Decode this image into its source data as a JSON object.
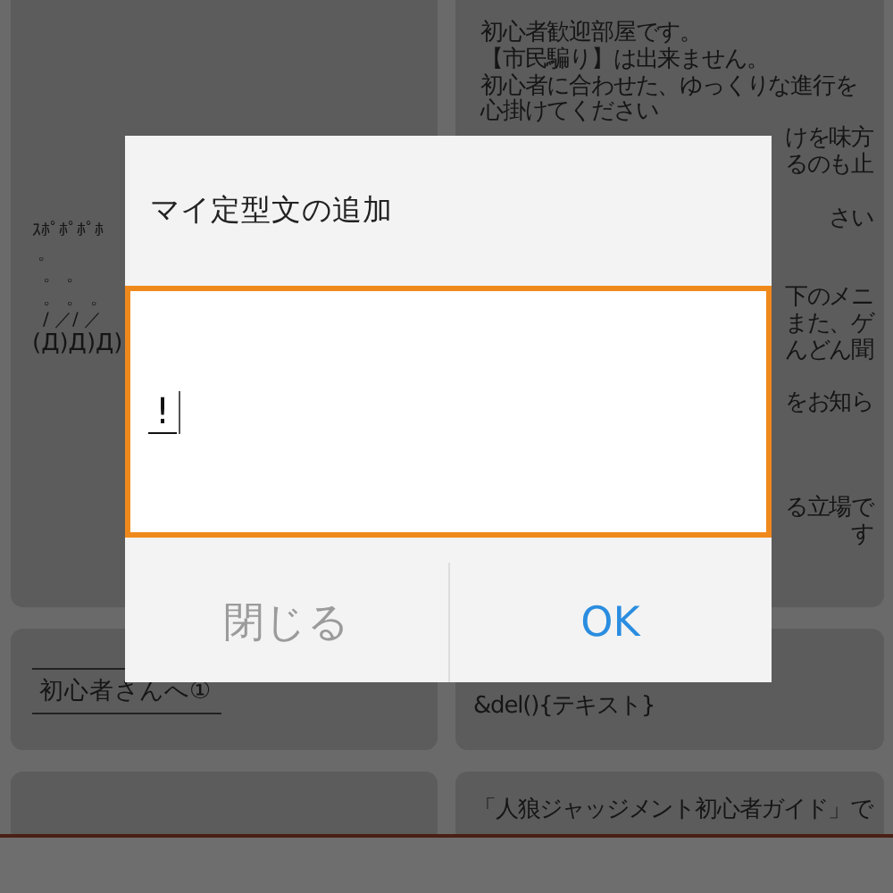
{
  "background": {
    "art": [
      "ｽﾎﾟﾎﾟﾎﾟﾎ",
      "。",
      "。 。",
      "。 。 。",
      "/ ／/ ／",
      "(Д)Д)Д)"
    ],
    "rules": [
      "初心者歓迎部屋です。",
      "【市民騙り】は出来ません。",
      "初心者に合わせた、ゆっくりな進行を",
      "心掛けてください",
      "けを味方",
      "るのも止",
      "さい",
      "下のメニ",
      "また、ゲ",
      "んどん聞",
      "をお知ら",
      "る立場で",
      "す"
    ],
    "link_label": "初心者さんへ①",
    "del_text": "&del(){テキスト}",
    "guide_text": "「人狼ジャッジメント初心者ガイド」で"
  },
  "dialog": {
    "title": "マイ定型文の追加",
    "input": {
      "value": "!",
      "focused": true
    },
    "buttons": [
      {
        "label": "閉じる",
        "kind": "cancel"
      },
      {
        "label": "OK",
        "kind": "confirm"
      }
    ]
  }
}
